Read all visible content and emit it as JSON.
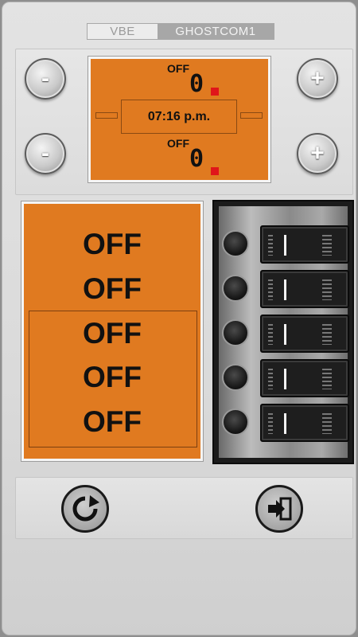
{
  "tabs": [
    {
      "label": "VBE",
      "active": false
    },
    {
      "label": "GHOSTCOM1",
      "active": true
    }
  ],
  "controls": {
    "top_minus": "-",
    "top_plus": "+",
    "bottom_minus": "-",
    "bottom_plus": "+"
  },
  "display": {
    "top_status": "OFF",
    "top_value": "0",
    "time": "07:16 p.m.",
    "bottom_status": "OFF",
    "bottom_value": "0"
  },
  "status_list": [
    "OFF",
    "OFF",
    "OFF",
    "OFF",
    "OFF"
  ],
  "switches": {
    "count": 5
  },
  "actions": {
    "refresh_icon": "refresh-icon",
    "exit_icon": "exit-icon"
  },
  "colors": {
    "display_orange": "#e07a20",
    "indicator_red": "#e0161a"
  }
}
